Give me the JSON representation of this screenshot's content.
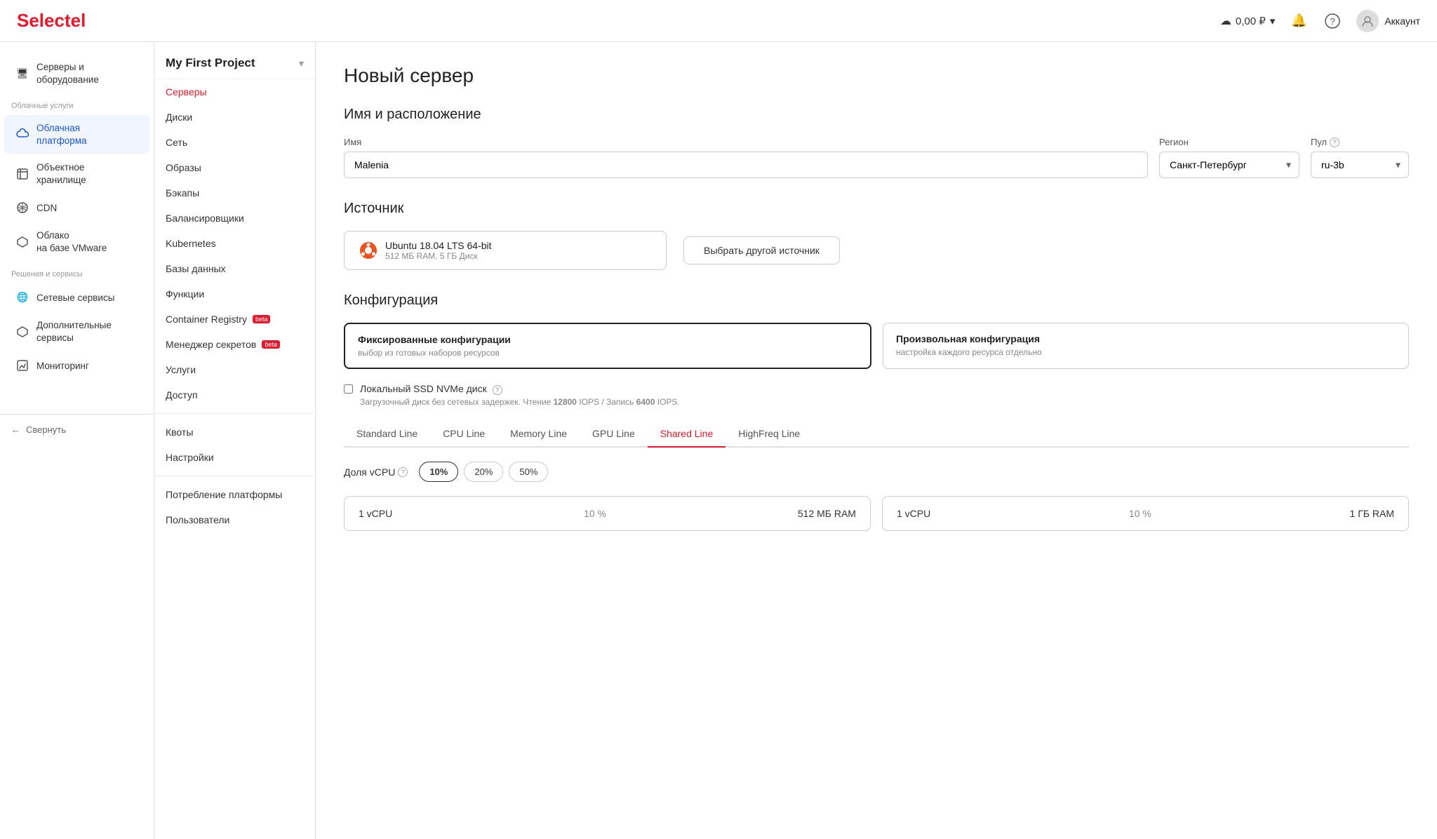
{
  "navbar": {
    "logo_s": "S",
    "logo_rest": "electel",
    "balance": "0,00 ₽",
    "account_label": "Аккаунт"
  },
  "sidebar_left": {
    "items": [
      {
        "id": "servers",
        "icon": "🖥",
        "label": "Серверы и оборудование",
        "active": false
      },
      {
        "id": "cloud",
        "icon": "☁",
        "label": "Облачная платформа",
        "active": true
      },
      {
        "id": "object",
        "icon": "◇",
        "label": "Объектное хранилище",
        "active": false
      },
      {
        "id": "cdn",
        "icon": "⬡",
        "label": "CDN",
        "active": false
      },
      {
        "id": "vmware",
        "icon": "⬡",
        "label": "Облако на базе VMware",
        "active": false
      }
    ],
    "section_solutions": "Решения и сервисы",
    "solutions": [
      {
        "id": "network",
        "icon": "🌐",
        "label": "Сетевые сервисы",
        "active": false
      },
      {
        "id": "extra",
        "icon": "⬡",
        "label": "Дополнительные сервисы",
        "active": false
      },
      {
        "id": "monitor",
        "icon": "⬡",
        "label": "Мониторинг",
        "active": false
      }
    ],
    "collapse_label": "Свернуть"
  },
  "sidebar_project": {
    "project_name": "My First Project",
    "menu_items": [
      {
        "id": "servers",
        "label": "Серверы",
        "active": true,
        "beta": false
      },
      {
        "id": "disks",
        "label": "Диски",
        "active": false,
        "beta": false
      },
      {
        "id": "network",
        "label": "Сеть",
        "active": false,
        "beta": false
      },
      {
        "id": "images",
        "label": "Образы",
        "active": false,
        "beta": false
      },
      {
        "id": "backups",
        "label": "Бэкапы",
        "active": false,
        "beta": false
      },
      {
        "id": "balancers",
        "label": "Балансировщики",
        "active": false,
        "beta": false
      },
      {
        "id": "kubernetes",
        "label": "Kubernetes",
        "active": false,
        "beta": false
      },
      {
        "id": "databases",
        "label": "Базы данных",
        "active": false,
        "beta": false
      },
      {
        "id": "functions",
        "label": "Функции",
        "active": false,
        "beta": false
      },
      {
        "id": "registry",
        "label": "Container Registry",
        "active": false,
        "beta": true
      },
      {
        "id": "secrets",
        "label": "Менеджер секретов",
        "active": false,
        "beta": true
      },
      {
        "id": "services",
        "label": "Услуги",
        "active": false,
        "beta": false
      },
      {
        "id": "access",
        "label": "Доступ",
        "active": false,
        "beta": false
      }
    ],
    "section_label": "",
    "bottom_items": [
      {
        "id": "quotas",
        "label": "Квоты"
      },
      {
        "id": "settings",
        "label": "Настройки"
      },
      {
        "id": "consumption",
        "label": "Потребление платформы"
      },
      {
        "id": "users",
        "label": "Пользователи"
      }
    ]
  },
  "main": {
    "page_title": "Новый сервер",
    "name_location": {
      "section_title": "Имя и расположение",
      "name_label": "Имя",
      "name_value": "Malenia",
      "region_label": "Регион",
      "region_value": "Санкт-Петербург",
      "pool_label": "Пул",
      "pool_value": "ru-3b"
    },
    "source": {
      "section_title": "Источник",
      "selected_os": "Ubuntu 18.04 LTS 64-bit",
      "selected_meta": "512 МБ RAM, 5 ГБ Диск",
      "change_btn": "Выбрать другой источник"
    },
    "config": {
      "section_title": "Конфигурация",
      "options": [
        {
          "id": "fixed",
          "title": "Фиксированные конфигурации",
          "sub": "выбор из готовых наборов ресурсов",
          "selected": true
        },
        {
          "id": "custom",
          "title": "Произвольная конфигурация",
          "sub": "настройка каждого ресурса отдельно",
          "selected": false
        }
      ],
      "local_ssd_label": "Локальный SSD NVMe диск",
      "local_ssd_desc": "Загрузочный диск без сетевых задержек. Чтение 12800 IOPS / Запись 6400 IOPS.",
      "local_ssd_bold1": "12800",
      "local_ssd_bold2": "6400",
      "tabs": [
        {
          "id": "standard",
          "label": "Standard Line",
          "active": false
        },
        {
          "id": "cpu",
          "label": "CPU Line",
          "active": false
        },
        {
          "id": "memory",
          "label": "Memory Line",
          "active": false
        },
        {
          "id": "gpu",
          "label": "GPU Line",
          "active": false
        },
        {
          "id": "shared",
          "label": "Shared Line",
          "active": true
        },
        {
          "id": "highfreq",
          "label": "HighFreq Line",
          "active": false
        }
      ],
      "vcpu_label": "Доля vCPU",
      "vcpu_options": [
        {
          "value": "10%",
          "selected": true
        },
        {
          "value": "20%",
          "selected": false
        },
        {
          "value": "50%",
          "selected": false
        }
      ],
      "server_cards": [
        {
          "vcpu": "1 vCPU",
          "pct": "10 %",
          "ram": "512 МБ RAM"
        },
        {
          "vcpu": "1 vCPU",
          "pct": "10 %",
          "ram": "1 ГБ RAM"
        }
      ]
    }
  }
}
